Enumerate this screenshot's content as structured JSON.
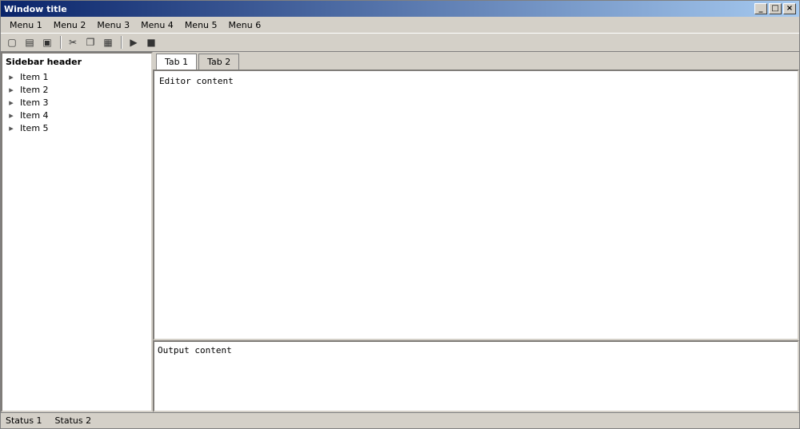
{
  "window": {
    "title": "Window title"
  },
  "menu": [
    "Menu 1",
    "Menu 2",
    "Menu 3",
    "Menu 4",
    "Menu 5",
    "Menu 6"
  ],
  "toolbar": [
    "new-icon",
    "open-icon",
    "save-icon",
    "cut-icon",
    "copy-icon",
    "paste-icon",
    "run-icon",
    "stop-icon"
  ],
  "sidebar": {
    "header": "Sidebar header",
    "items": [
      "Item 1",
      "Item 2",
      "Item 3",
      "Item 4",
      "Item 5"
    ]
  },
  "tabs": [
    {
      "label": "Tab 1"
    },
    {
      "label": "Tab 2"
    }
  ],
  "editor": {
    "text": "Editor content"
  },
  "output": {
    "text": "Output content"
  },
  "status": [
    "Status 1",
    "Status 2"
  ]
}
